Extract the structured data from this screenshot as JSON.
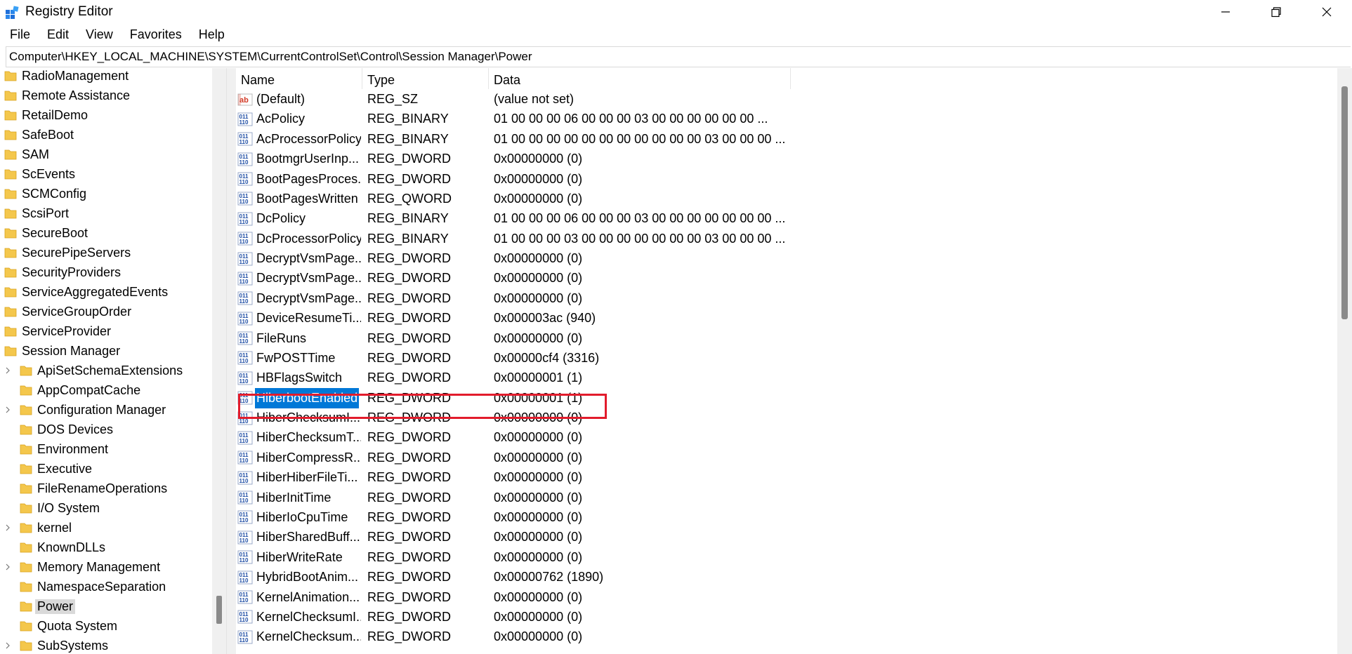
{
  "window": {
    "title": "Registry Editor",
    "controls": {
      "minimize": "minimize-icon",
      "restore": "restore-icon",
      "close": "close-icon"
    }
  },
  "menu": [
    "File",
    "Edit",
    "View",
    "Favorites",
    "Help"
  ],
  "address": "Computer\\HKEY_LOCAL_MACHINE\\SYSTEM\\CurrentControlSet\\Control\\Session Manager\\Power",
  "tree": [
    {
      "label": "RadioManagement",
      "level": 0,
      "expandable": false
    },
    {
      "label": "Remote Assistance",
      "level": 0,
      "expandable": false
    },
    {
      "label": "RetailDemo",
      "level": 0,
      "expandable": false
    },
    {
      "label": "SafeBoot",
      "level": 0,
      "expandable": false
    },
    {
      "label": "SAM",
      "level": 0,
      "expandable": false
    },
    {
      "label": "ScEvents",
      "level": 0,
      "expandable": false
    },
    {
      "label": "SCMConfig",
      "level": 0,
      "expandable": false
    },
    {
      "label": "ScsiPort",
      "level": 0,
      "expandable": false
    },
    {
      "label": "SecureBoot",
      "level": 0,
      "expandable": false
    },
    {
      "label": "SecurePipeServers",
      "level": 0,
      "expandable": false
    },
    {
      "label": "SecurityProviders",
      "level": 0,
      "expandable": false
    },
    {
      "label": "ServiceAggregatedEvents",
      "level": 0,
      "expandable": false
    },
    {
      "label": "ServiceGroupOrder",
      "level": 0,
      "expandable": false
    },
    {
      "label": "ServiceProvider",
      "level": 0,
      "expandable": false
    },
    {
      "label": "Session Manager",
      "level": 0,
      "expandable": false
    },
    {
      "label": "ApiSetSchemaExtensions",
      "level": 1,
      "expandable": true
    },
    {
      "label": "AppCompatCache",
      "level": 1,
      "expandable": false
    },
    {
      "label": "Configuration Manager",
      "level": 1,
      "expandable": true
    },
    {
      "label": "DOS Devices",
      "level": 1,
      "expandable": false
    },
    {
      "label": "Environment",
      "level": 1,
      "expandable": false
    },
    {
      "label": "Executive",
      "level": 1,
      "expandable": false
    },
    {
      "label": "FileRenameOperations",
      "level": 1,
      "expandable": false
    },
    {
      "label": "I/O System",
      "level": 1,
      "expandable": false
    },
    {
      "label": "kernel",
      "level": 1,
      "expandable": true
    },
    {
      "label": "KnownDLLs",
      "level": 1,
      "expandable": false
    },
    {
      "label": "Memory Management",
      "level": 1,
      "expandable": true
    },
    {
      "label": "NamespaceSeparation",
      "level": 1,
      "expandable": false
    },
    {
      "label": "Power",
      "level": 1,
      "expandable": false,
      "selected": true
    },
    {
      "label": "Quota System",
      "level": 1,
      "expandable": false
    },
    {
      "label": "SubSystems",
      "level": 1,
      "expandable": true
    }
  ],
  "columns": {
    "name": "Name",
    "type": "Type",
    "data": "Data"
  },
  "values": [
    {
      "name": "(Default)",
      "type": "REG_SZ",
      "data": "(value not set)",
      "icon": "string-value-icon"
    },
    {
      "name": "AcPolicy",
      "type": "REG_BINARY",
      "data": "01 00 00 00 06 00 00 00 03 00 00 00 00 00 00 ...",
      "icon": "binary-value-icon"
    },
    {
      "name": "AcProcessorPolicy",
      "type": "REG_BINARY",
      "data": "01 00 00 00 00 00 00 00 00 00 00 00 03 00 00 00 ...",
      "icon": "binary-value-icon"
    },
    {
      "name": "BootmgrUserInp...",
      "type": "REG_DWORD",
      "data": "0x00000000 (0)",
      "icon": "binary-value-icon"
    },
    {
      "name": "BootPagesProces...",
      "type": "REG_DWORD",
      "data": "0x00000000 (0)",
      "icon": "binary-value-icon"
    },
    {
      "name": "BootPagesWritten",
      "type": "REG_QWORD",
      "data": "0x00000000 (0)",
      "icon": "binary-value-icon"
    },
    {
      "name": "DcPolicy",
      "type": "REG_BINARY",
      "data": "01 00 00 00 06 00 00 00 03 00 00 00 00 00 00 00 ...",
      "icon": "binary-value-icon"
    },
    {
      "name": "DcProcessorPolicy",
      "type": "REG_BINARY",
      "data": "01 00 00 00 03 00 00 00 00 00 00 00 03 00 00 00 ...",
      "icon": "binary-value-icon"
    },
    {
      "name": "DecryptVsmPage...",
      "type": "REG_DWORD",
      "data": "0x00000000 (0)",
      "icon": "binary-value-icon"
    },
    {
      "name": "DecryptVsmPage...",
      "type": "REG_DWORD",
      "data": "0x00000000 (0)",
      "icon": "binary-value-icon"
    },
    {
      "name": "DecryptVsmPage...",
      "type": "REG_DWORD",
      "data": "0x00000000 (0)",
      "icon": "binary-value-icon"
    },
    {
      "name": "DeviceResumeTi...",
      "type": "REG_DWORD",
      "data": "0x000003ac (940)",
      "icon": "binary-value-icon"
    },
    {
      "name": "FileRuns",
      "type": "REG_DWORD",
      "data": "0x00000000 (0)",
      "icon": "binary-value-icon"
    },
    {
      "name": "FwPOSTTime",
      "type": "REG_DWORD",
      "data": "0x00000cf4 (3316)",
      "icon": "binary-value-icon"
    },
    {
      "name": "HBFlagsSwitch",
      "type": "REG_DWORD",
      "data": "0x00000001 (1)",
      "icon": "binary-value-icon"
    },
    {
      "name": "HiberbootEnabled",
      "type": "REG_DWORD",
      "data": "0x00000001 (1)",
      "icon": "binary-value-icon",
      "selected": true
    },
    {
      "name": "HiberChecksumI...",
      "type": "REG_DWORD",
      "data": "0x00000000 (0)",
      "icon": "binary-value-icon"
    },
    {
      "name": "HiberChecksumT...",
      "type": "REG_DWORD",
      "data": "0x00000000 (0)",
      "icon": "binary-value-icon"
    },
    {
      "name": "HiberCompressR...",
      "type": "REG_DWORD",
      "data": "0x00000000 (0)",
      "icon": "binary-value-icon"
    },
    {
      "name": "HiberHiberFileTi...",
      "type": "REG_DWORD",
      "data": "0x00000000 (0)",
      "icon": "binary-value-icon"
    },
    {
      "name": "HiberInitTime",
      "type": "REG_DWORD",
      "data": "0x00000000 (0)",
      "icon": "binary-value-icon"
    },
    {
      "name": "HiberIoCpuTime",
      "type": "REG_DWORD",
      "data": "0x00000000 (0)",
      "icon": "binary-value-icon"
    },
    {
      "name": "HiberSharedBuff...",
      "type": "REG_DWORD",
      "data": "0x00000000 (0)",
      "icon": "binary-value-icon"
    },
    {
      "name": "HiberWriteRate",
      "type": "REG_DWORD",
      "data": "0x00000000 (0)",
      "icon": "binary-value-icon"
    },
    {
      "name": "HybridBootAnim...",
      "type": "REG_DWORD",
      "data": "0x00000762 (1890)",
      "icon": "binary-value-icon"
    },
    {
      "name": "KernelAnimation...",
      "type": "REG_DWORD",
      "data": "0x00000000 (0)",
      "icon": "binary-value-icon"
    },
    {
      "name": "KernelChecksumI...",
      "type": "REG_DWORD",
      "data": "0x00000000 (0)",
      "icon": "binary-value-icon"
    },
    {
      "name": "KernelChecksum...",
      "type": "REG_DWORD",
      "data": "0x00000000 (0)",
      "icon": "binary-value-icon"
    }
  ],
  "colors": {
    "selection": "#0078d7",
    "highlight_border": "#e21c2c",
    "folder": "#f4c74c",
    "tree_selected": "#d9d9d9"
  }
}
